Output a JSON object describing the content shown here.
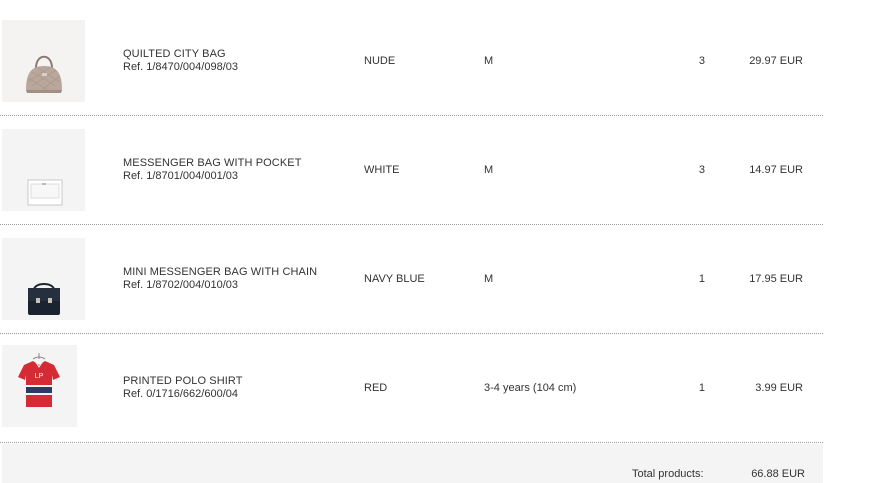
{
  "items": [
    {
      "name": "QUILTED CITY BAG",
      "ref": "Ref. 1/8470/004/098/03",
      "color": "NUDE",
      "size": "M",
      "quantity": "3",
      "price": "29.97 EUR",
      "image": "quilted-bag-thumbnail"
    },
    {
      "name": "MESSENGER BAG WITH POCKET",
      "ref": "Ref. 1/8701/004/001/03",
      "color": "WHITE",
      "size": "M",
      "quantity": "3",
      "price": "14.97 EUR",
      "image": "white-messenger-bag-thumbnail"
    },
    {
      "name": "MINI MESSENGER BAG WITH CHAIN",
      "ref": "Ref. 1/8702/004/010/03",
      "color": "NAVY BLUE",
      "size": "M",
      "quantity": "1",
      "price": "17.95 EUR",
      "image": "navy-messenger-bag-thumbnail"
    },
    {
      "name": "PRINTED POLO SHIRT",
      "ref": "Ref. 0/1716/662/600/04",
      "color": "RED",
      "size": "3-4 years (104 cm)",
      "quantity": "1",
      "price": "3.99 EUR",
      "image": "red-polo-shirt-thumbnail"
    }
  ],
  "totals": {
    "label": "Total products:",
    "value": "66.88 EUR"
  },
  "colors": {
    "separator": "#9a9a9a",
    "footer_bg": "#f4f4f4",
    "text": "#333333"
  }
}
